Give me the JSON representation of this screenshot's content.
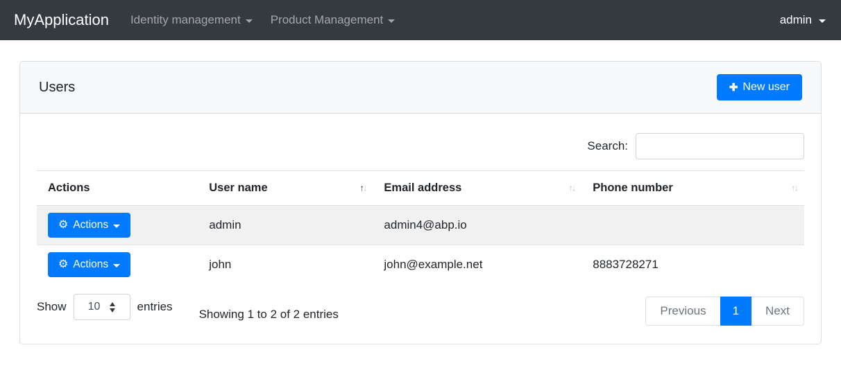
{
  "navbar": {
    "brand": "MyApplication",
    "items": [
      {
        "label": "Identity management"
      },
      {
        "label": "Product Management"
      }
    ],
    "user_menu": {
      "label": "admin"
    }
  },
  "page": {
    "title": "Users",
    "new_user_button": {
      "label": "New user"
    }
  },
  "search": {
    "label": "Search:",
    "value": "",
    "placeholder": ""
  },
  "table": {
    "columns": [
      {
        "label": "Actions",
        "sortable": false,
        "sort": "none"
      },
      {
        "label": "User name",
        "sortable": true,
        "sort": "asc"
      },
      {
        "label": "Email address",
        "sortable": true,
        "sort": "none"
      },
      {
        "label": "Phone number",
        "sortable": true,
        "sort": "none"
      }
    ],
    "rows": [
      {
        "actions_label": "Actions",
        "user_name": "admin",
        "email": "admin4@abp.io",
        "phone": ""
      },
      {
        "actions_label": "Actions",
        "user_name": "john",
        "email": "john@example.net",
        "phone": "8883728271"
      }
    ]
  },
  "footer": {
    "show_label": "Show",
    "page_size": "10",
    "entries_label": "entries",
    "info": "Showing 1 to 2 of 2 entries",
    "pagination": {
      "previous": "Previous",
      "current": "1",
      "next": "Next"
    }
  },
  "icons": {
    "plus": "✚",
    "gear": "⚙",
    "sort_up": "↑",
    "sort_down": "↓"
  },
  "colors": {
    "primary": "#007bff",
    "navbar_bg": "#343a40",
    "card_header_bg": "#f8f9fa",
    "stripe": "#f2f2f2",
    "border": "#dee2e6",
    "muted_text": "#6c757d"
  }
}
